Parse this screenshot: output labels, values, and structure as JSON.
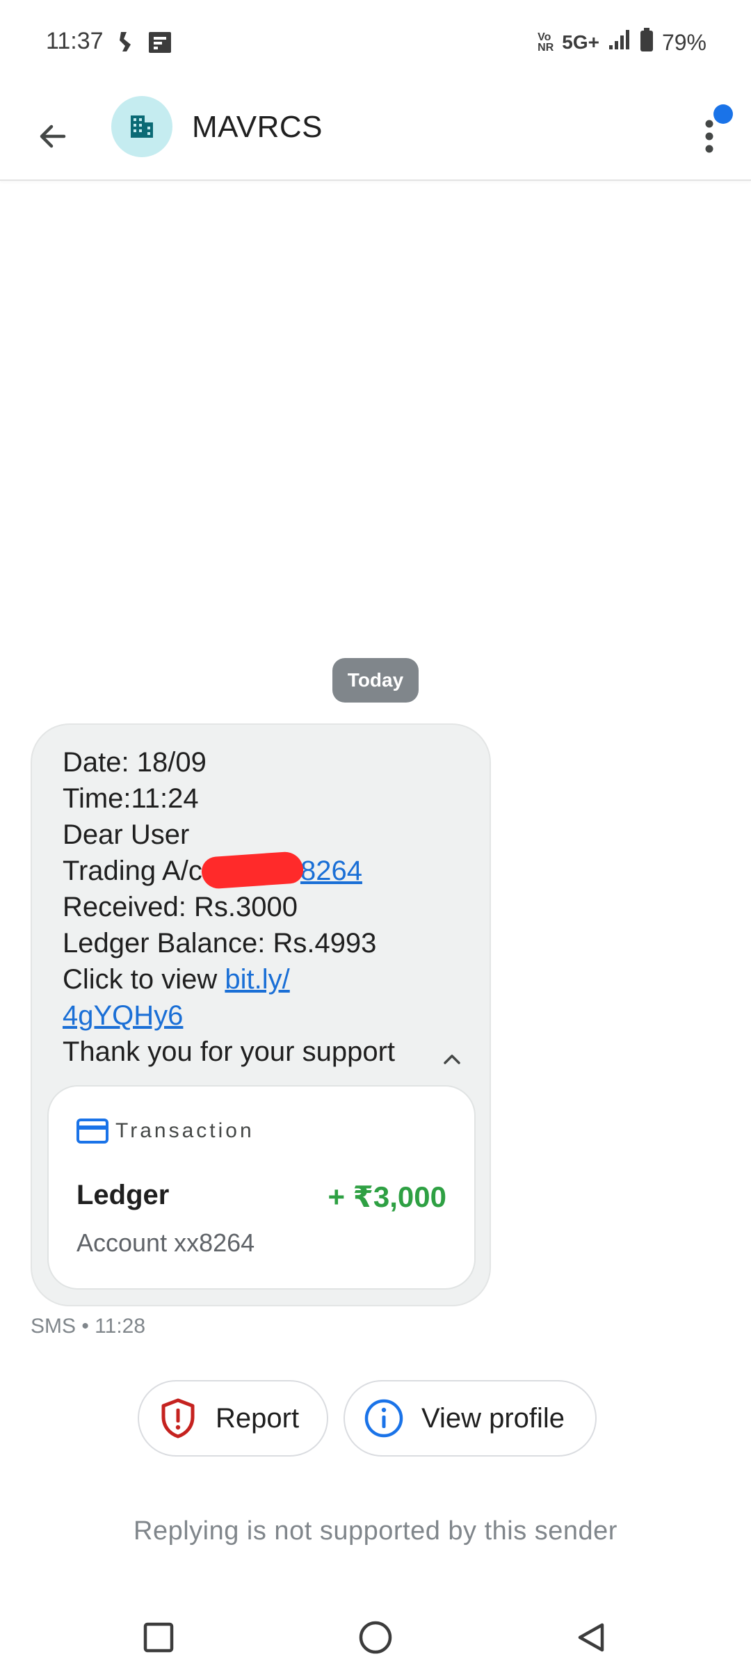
{
  "status_bar": {
    "time": "11:37",
    "volte_top": "Vo",
    "volte_bottom": "NR",
    "network": "5G+",
    "battery": "79%",
    "icons": [
      "missed-call-icon",
      "notification-icon",
      "signal-icon",
      "battery-icon"
    ]
  },
  "app_bar": {
    "sender": "MAVRCS",
    "avatar_icon": "building-icon",
    "avatar_bg": "#c5ecf0",
    "badge_color": "#1a73e8"
  },
  "conversation": {
    "date_chip": "Today",
    "message": {
      "date_line": "Date: 18/09",
      "time_line": "Time:11:24",
      "greeting": "Dear User",
      "account_prefix": "Trading A/c:",
      "account_link": "8264",
      "received": "Received: Rs.3000",
      "balance": "Ledger Balance: Rs.4993",
      "view_prefix": "Click to view ",
      "url_part1": "bit.ly/",
      "url_part2": "4gYQHy6",
      "thanks": "Thank you for your support"
    },
    "transaction_card": {
      "header": "Transaction",
      "title": "Ledger",
      "amount": "+ ₹3,000",
      "account": "Account xx8264",
      "amount_color": "#2ea043"
    },
    "meta": "SMS • 11:28"
  },
  "actions": {
    "report": "Report",
    "view_profile": "View profile"
  },
  "footer": {
    "no_reply": "Replying is not supported by this sender"
  }
}
